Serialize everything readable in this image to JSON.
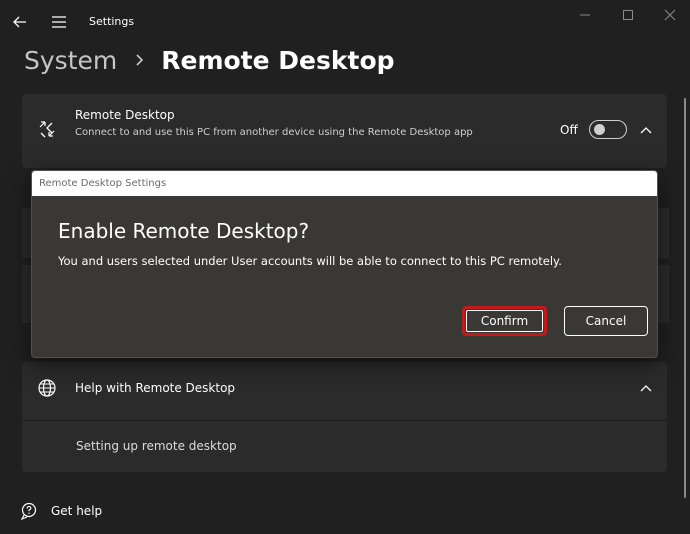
{
  "window": {
    "title": "Settings"
  },
  "breadcrumb": {
    "parent": "System",
    "current": "Remote Desktop"
  },
  "remote_desktop_card": {
    "title": "Remote Desktop",
    "description": "Connect to and use this PC from another device using the Remote Desktop app",
    "toggle_state": "Off",
    "toggle_on": false
  },
  "help_card": {
    "title": "Help with Remote Desktop",
    "link": "Setting up remote desktop"
  },
  "footer": {
    "get_help": "Get help"
  },
  "dialog": {
    "caption": "Remote Desktop Settings",
    "heading": "Enable Remote Desktop?",
    "body": "You and users selected under User accounts will be able to connect to this PC remotely.",
    "confirm_label": "Confirm",
    "cancel_label": "Cancel"
  },
  "colors": {
    "background": "#202020",
    "card": "#2b2b2b",
    "dialog": "#3a3835",
    "highlight": "#c21a1a"
  }
}
